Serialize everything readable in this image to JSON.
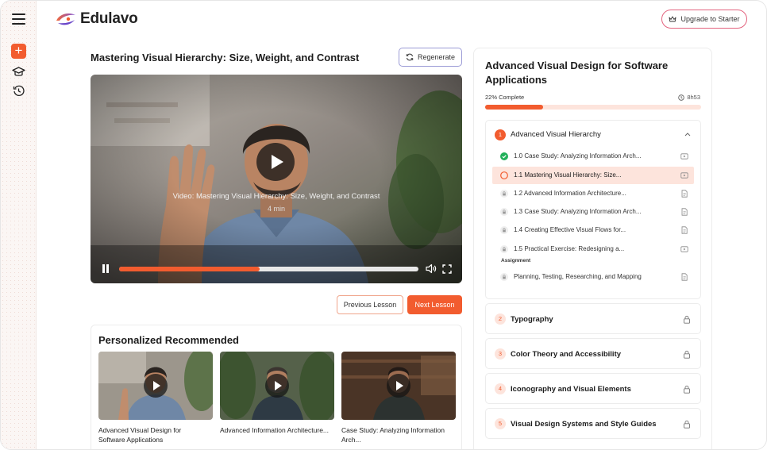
{
  "header": {
    "brand": "Edulavo",
    "upgrade_label": "Upgrade to Starter"
  },
  "rail": {
    "icons": [
      "menu-icon",
      "plus-icon",
      "graduation-cap-icon",
      "history-icon"
    ]
  },
  "lesson": {
    "title": "Mastering Visual Hierarchy: Size, Weight, and Contrast",
    "regenerate_label": "Regenerate",
    "video_caption": "Video: Mastering Visual Hierarchy: Size, Weight, and Contrast",
    "video_duration": "4 min",
    "video_progress": 0.47,
    "prev_label": "Previous Lesson",
    "next_label": "Next Lesson"
  },
  "recommended": {
    "title": "Personalized Recommended",
    "items": [
      {
        "title": "Advanced Visual Design for Software Applications"
      },
      {
        "title": "Advanced Information Architecture..."
      },
      {
        "title": "Case Study: Analyzing Information Arch..."
      }
    ]
  },
  "course": {
    "title": "Advanced Visual Design for Software Applications",
    "progress_label": "22% Complete",
    "progress": 0.27,
    "duration": "8h53",
    "open_module": {
      "number": "1",
      "title": "Advanced Visual Hierarchy",
      "lessons": [
        {
          "title": "1.0 Case Study: Analyzing Information Arch...",
          "status": "complete",
          "type": "video"
        },
        {
          "title": "1.1 Mastering Visual Hierarchy: Size...",
          "status": "current",
          "type": "video"
        },
        {
          "title": "1.2 Advanced Information Architecture...",
          "status": "locked",
          "type": "document"
        },
        {
          "title": "1.3 Case Study: Analyzing Information Arch...",
          "status": "locked",
          "type": "document"
        },
        {
          "title": "1.4 Creating Effective Visual Flows for...",
          "status": "locked",
          "type": "document"
        },
        {
          "title": "1.5 Practical Exercise: Redesigning a...",
          "status": "locked",
          "type": "video"
        }
      ],
      "assignment_label": "Assignment",
      "assignment": {
        "title": "Planning, Testing, Researching, and Mapping",
        "status": "locked",
        "type": "document"
      }
    },
    "modules": [
      {
        "number": "2",
        "title": "Typography"
      },
      {
        "number": "3",
        "title": "Color Theory and Accessibility"
      },
      {
        "number": "4",
        "title": "Iconography and Visual Elements"
      },
      {
        "number": "5",
        "title": "Visual Design Systems and Style Guides"
      }
    ]
  },
  "colors": {
    "accent": "#f25c2f",
    "accent_light": "#fde4dc",
    "success": "#22b05a"
  }
}
